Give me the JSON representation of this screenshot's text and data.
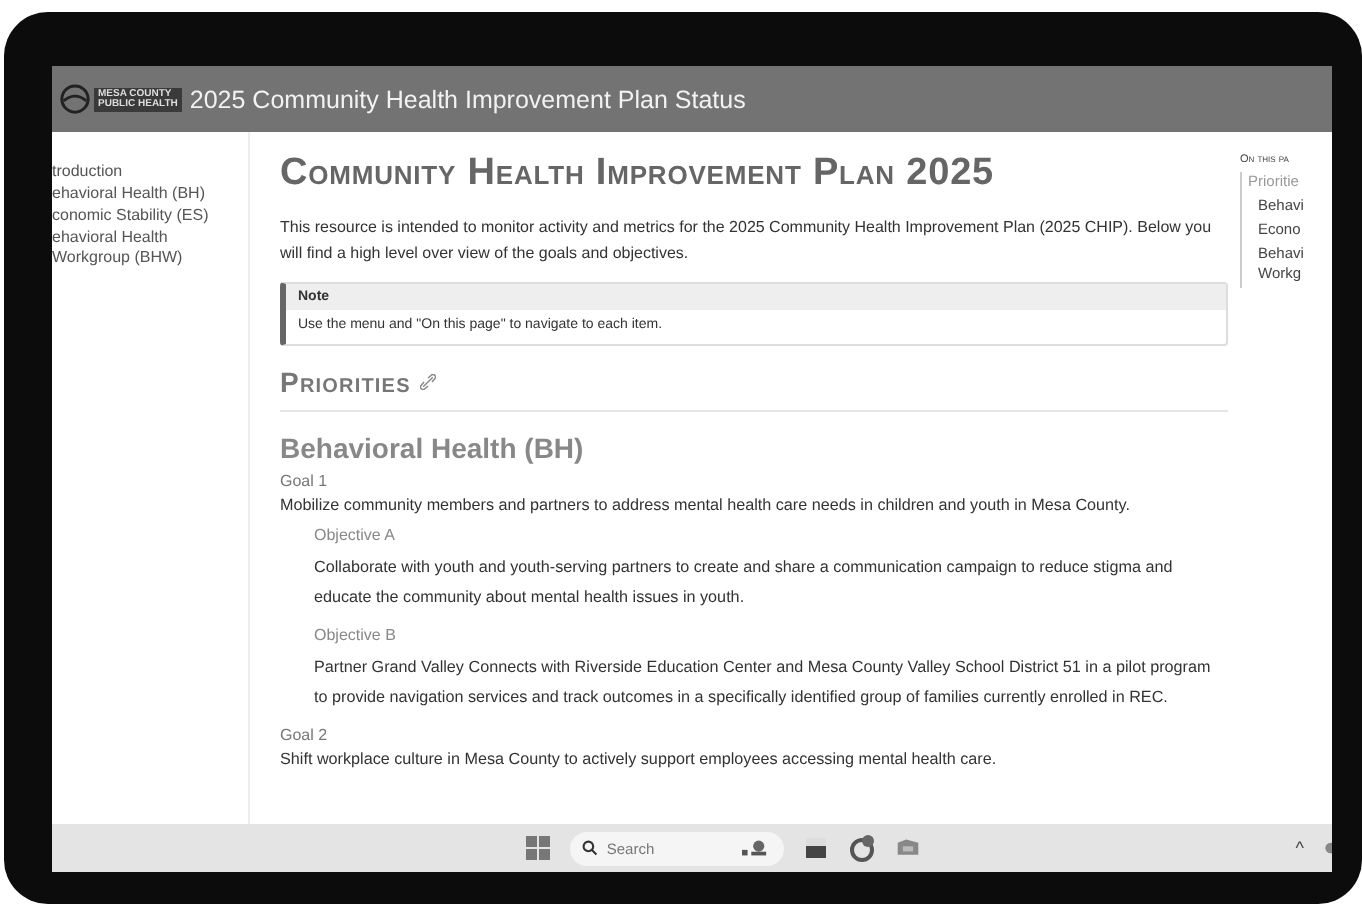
{
  "window": {
    "logo_text": [
      "MESA COUNTY",
      "PUBLIC HEALTH"
    ],
    "title": "2025 Community Health Improvement Plan Status"
  },
  "sidebar": {
    "items": [
      {
        "label": "troduction"
      },
      {
        "label": "ehavioral Health (BH)"
      },
      {
        "label": "conomic Stability (ES)"
      },
      {
        "label": "ehavioral Health Workgroup (BHW)"
      }
    ]
  },
  "page": {
    "title": "Community Health Improvement Plan 2025",
    "intro": "This resource is intended to monitor activity and metrics for the 2025 Community Health Improvement Plan (2025 CHIP). Below you will find a high level over view of the goals and objectives.",
    "note": {
      "label": "Note",
      "text": "Use the menu and \"On this page\" to navigate to each item."
    },
    "section": "Priorities",
    "groups": [
      {
        "heading": "Behavioral Health (BH)",
        "goals": [
          {
            "label": "Goal 1",
            "text": "Mobilize community members and partners to address mental health care needs in children and youth in Mesa County.",
            "objectives": [
              {
                "label": "Objective A",
                "text": "Collaborate with youth and youth-serving partners to create and share a communication campaign to reduce stigma and educate the community about mental health issues in youth."
              },
              {
                "label": "Objective B",
                "text": "Partner Grand Valley Connects with Riverside Education Center and Mesa County Valley School District 51 in a pilot program to provide navigation services and track outcomes in a specifically identified group of families currently enrolled in REC."
              }
            ]
          },
          {
            "label": "Goal 2",
            "text": "Shift workplace culture in Mesa County to actively support employees accessing mental health care."
          }
        ]
      }
    ]
  },
  "toc": {
    "heading": "On this pa",
    "items": [
      {
        "label": "Prioritie",
        "children": [
          {
            "label": "Behavi"
          },
          {
            "label": "Econo"
          },
          {
            "label": "Behavi Workg"
          }
        ]
      }
    ]
  },
  "taskbar": {
    "search": {
      "placeholder": "Search"
    },
    "tray": "^"
  }
}
